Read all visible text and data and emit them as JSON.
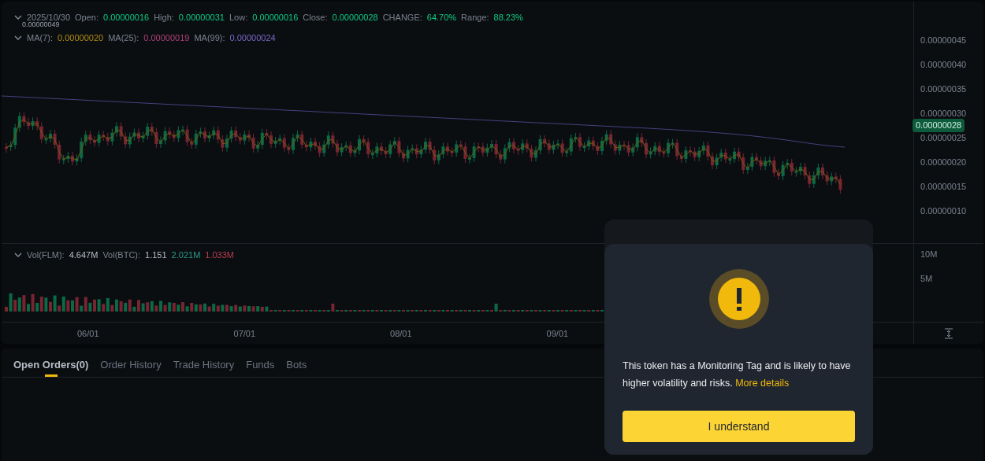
{
  "chart": {
    "ohlc_legend": [
      {
        "label": "2025/10/30",
        "kind": "date"
      },
      {
        "label": "Open:",
        "value": "0.00000016",
        "kind": "field"
      },
      {
        "label": "High:",
        "value": "0.00000031",
        "kind": "field"
      },
      {
        "label": "Low:",
        "value": "0.00000016",
        "kind": "field"
      },
      {
        "label": "Close:",
        "value": "0.00000028",
        "kind": "field"
      },
      {
        "label": "CHANGE:",
        "value": "64.70%",
        "kind": "field"
      },
      {
        "label": "Range:",
        "value": "88.23%",
        "kind": "field"
      }
    ],
    "ma_legend": [
      {
        "label": "MA(7):",
        "value": "0.00000020",
        "color": "#b08a14"
      },
      {
        "label": "MA(25):",
        "value": "0.00000019",
        "color": "#b0407a"
      },
      {
        "label": "MA(99):",
        "value": "0.00000024",
        "color": "#7a66c8"
      }
    ],
    "high_marker": "0.00000049",
    "price_ticks": [
      "0.00000045",
      "0.00000040",
      "0.00000035",
      "0.00000030",
      "0.00000025",
      "0.00000020",
      "0.00000015",
      "0.00000010"
    ],
    "current_price": "0.00000028",
    "volume_legend": [
      {
        "label": "Vol(FLM):",
        "value": "4.647M",
        "color": "#b7bdc6"
      },
      {
        "label": "Vol(BTC):",
        "value": "1.151",
        "color": "#b7bdc6"
      },
      {
        "value": "2.021M",
        "color": "#2a9a8a"
      },
      {
        "value": "1.033M",
        "color": "#b83c50"
      }
    ],
    "volume_ticks": [
      "10M",
      "5M"
    ],
    "time_ticks": [
      "06/01",
      "07/01",
      "08/01",
      "09/01"
    ]
  },
  "order_tabs": [
    {
      "label": "Open Orders(0)",
      "selected": true
    },
    {
      "label": "Order History",
      "selected": false
    },
    {
      "label": "Trade History",
      "selected": false
    },
    {
      "label": "Funds",
      "selected": false
    },
    {
      "label": "Bots",
      "selected": false
    }
  ],
  "modal": {
    "message": "This token has a Monitoring Tag and is likely to have higher volatility and risks.",
    "link": "More details",
    "button": "I understand"
  }
}
